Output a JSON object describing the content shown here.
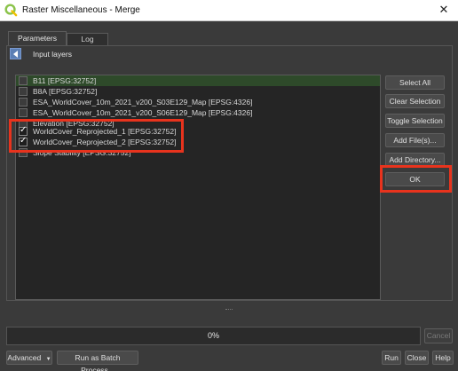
{
  "window": {
    "title": "Raster Miscellaneous - Merge",
    "close_glyph": "✕"
  },
  "tabs": [
    {
      "label": "Parameters"
    },
    {
      "label": "Log"
    }
  ],
  "group": {
    "label": "Input layers",
    "icon": "collapse-arrow-icon"
  },
  "layers": [
    {
      "name": "B11 [EPSG:32752]",
      "checked": false
    },
    {
      "name": "B8A [EPSG:32752]",
      "checked": false
    },
    {
      "name": "ESA_WorldCover_10m_2021_v200_S03E129_Map [EPSG:4326]",
      "checked": false
    },
    {
      "name": "ESA_WorldCover_10m_2021_v200_S06E129_Map [EPSG:4326]",
      "checked": false
    },
    {
      "name": "Elevation [EPSG:32752]",
      "checked": false
    },
    {
      "name": "WorldCover_Reprojected_1 [EPSG:32752]",
      "checked": true
    },
    {
      "name": "WorldCover_Reprojected_2 [EPSG:32752]",
      "checked": true
    },
    {
      "name": "Slope Stability [EPSG:32752]",
      "checked": false
    }
  ],
  "side_buttons": {
    "select_all": "Select All",
    "clear_selection": "Clear Selection",
    "toggle_selection": "Toggle Selection",
    "add_files": "Add File(s)...",
    "add_directory": "Add Directory...",
    "ok": "OK"
  },
  "progress": {
    "text": "0%",
    "value": 0
  },
  "footer": {
    "advanced": "Advanced",
    "batch": "Run as Batch Process...",
    "cancel": "Cancel",
    "run": "Run",
    "close": "Close",
    "help": "Help"
  },
  "colors": {
    "highlight": "#e8331d",
    "qgis_green": "#8bc34a"
  }
}
